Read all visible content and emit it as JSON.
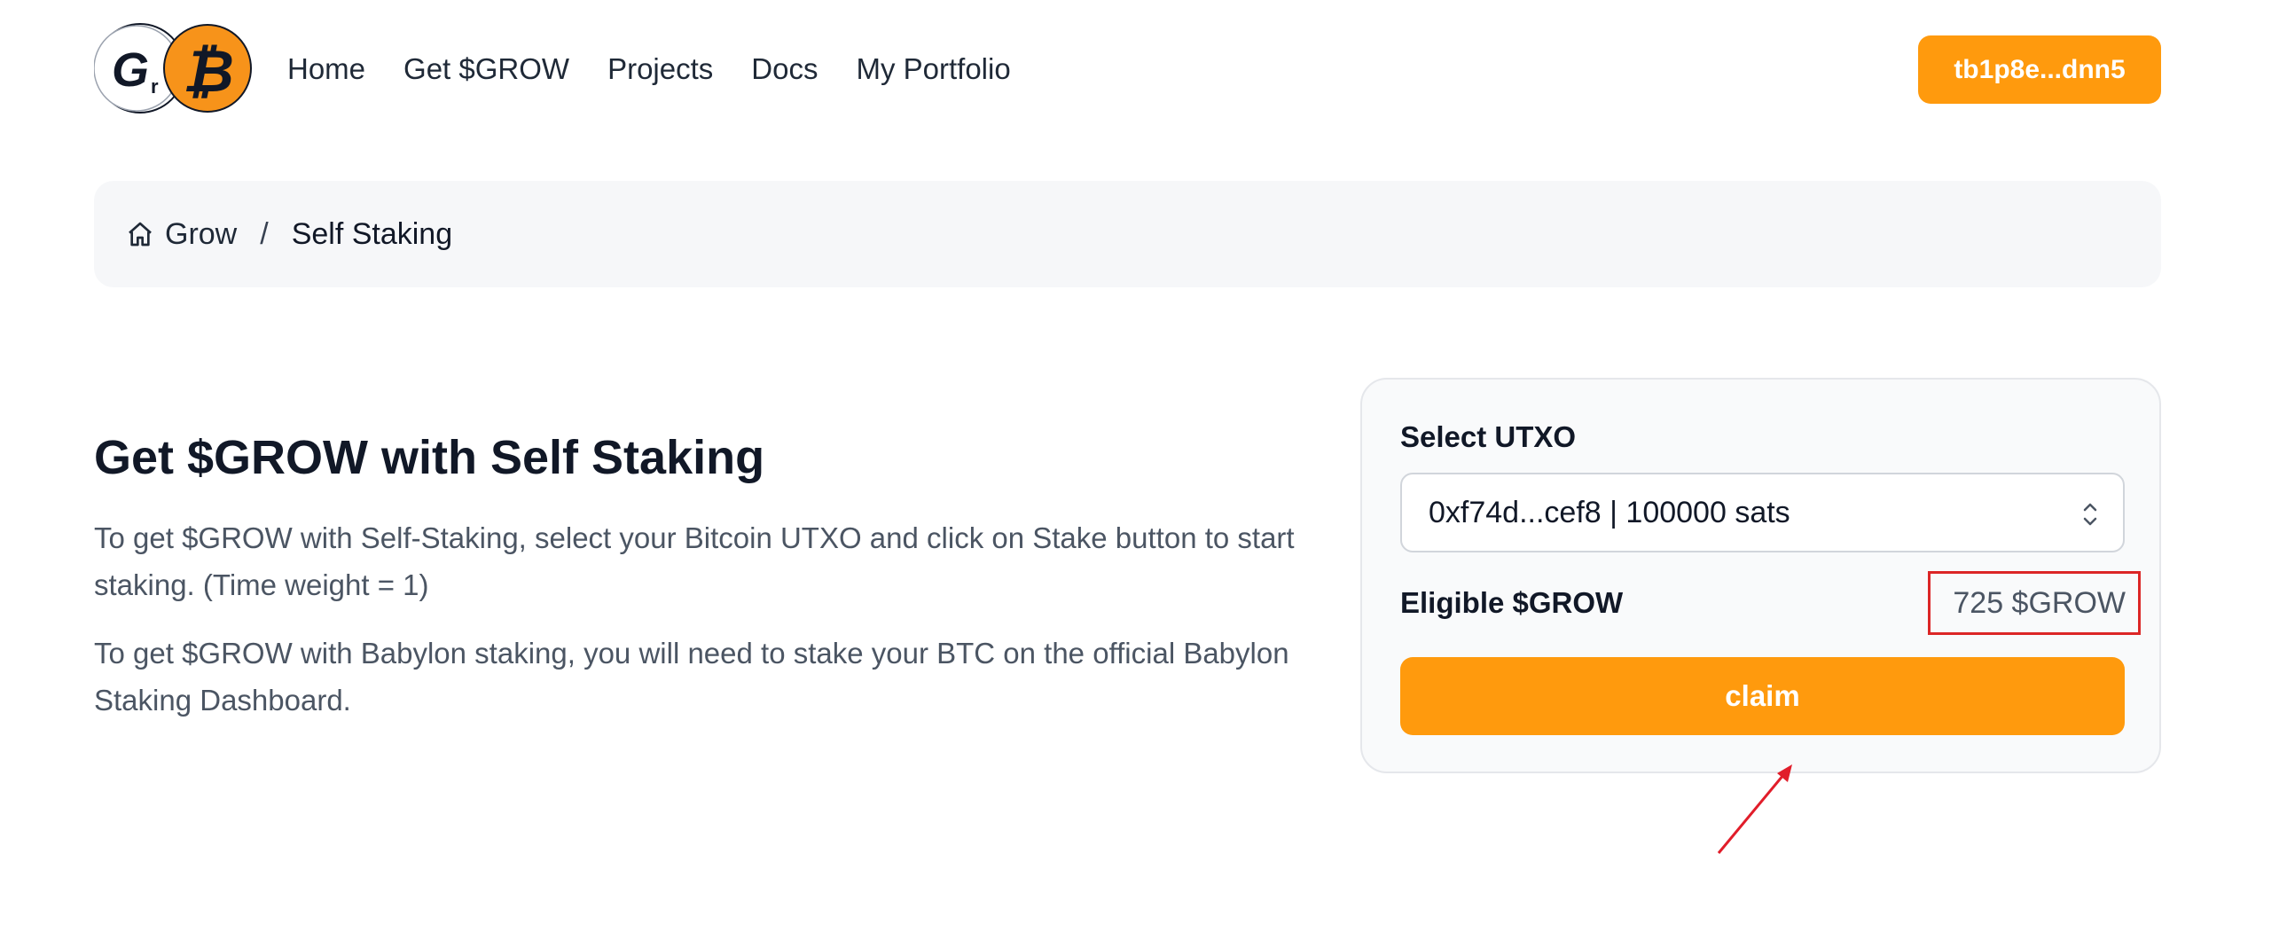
{
  "header": {
    "logo_letters": "GrB",
    "nav": [
      "Home",
      "Get $GROW",
      "Projects",
      "Docs",
      "My Portfolio"
    ],
    "wallet_button": "tb1p8e...dnn5",
    "accent_color": "#ff9a0d"
  },
  "breadcrumb": {
    "home_icon": "home-icon",
    "home_label": "Grow",
    "separator": "/",
    "current": "Self Staking"
  },
  "main": {
    "headline": "Get $GROW with Self Staking",
    "paragraph_1": "To get $GROW with Self-Staking, select your Bitcoin UTXO and click on Stake button to start staking. (Time weight = 1)",
    "paragraph_2": "To get $GROW with Babylon staking, you will need to stake your BTC on the official Babylon Staking Dashboard."
  },
  "card": {
    "select_label": "Select UTXO",
    "selected_utxo": "0xf74d...cef8 | 100000 sats",
    "eligible_label": "Eligible $GROW",
    "eligible_value": "725 $GROW",
    "claim_button": "claim",
    "highlight_color": "#dc2626"
  }
}
